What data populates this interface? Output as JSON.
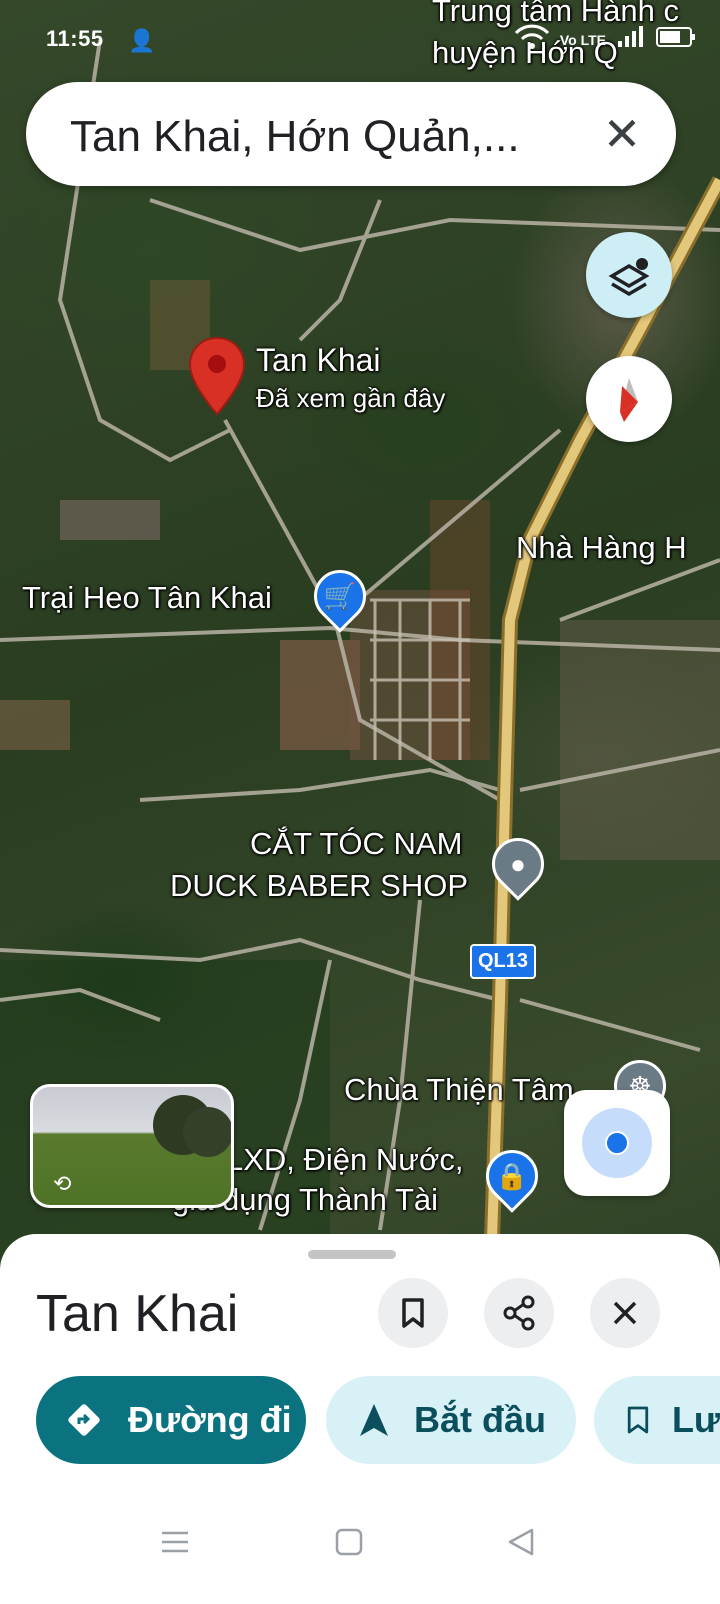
{
  "status_bar": {
    "time": "11:55",
    "network_label": "Vo LTE",
    "icons": [
      "person-add-icon",
      "wifi-icon",
      "signal-icon",
      "battery-icon"
    ]
  },
  "search": {
    "query": "Tan Khai, Hớn Quản,...",
    "clear_icon": "close-icon"
  },
  "map": {
    "top_label": "Trung tâm Hành c\nhuyện Hớn Q",
    "selected_place": {
      "name": "Tan Khai",
      "subtitle": "Đã xem gần đây"
    },
    "labels": {
      "restaurant": "Nhà Hàng H",
      "pig_farm": "Trại Heo Tân Khai",
      "barber_line1": "CẮT TÓC NAM",
      "barber_line2": "DUCK BABER SHOP",
      "road_badge": "QL13",
      "temple": "Chùa Thiện Tâm",
      "store_line1": "LXD, Điện Nước,",
      "store_line2": "gia dụng Thành Tài"
    },
    "colors": {
      "pin_red": "#d93025",
      "poi_blue": "#1a73e8",
      "highway": "#d4b56a",
      "location_blue": "#1a73e8"
    }
  },
  "sheet": {
    "title": "Tan Khai",
    "buttons": {
      "save_icon": "bookmark-icon",
      "share_icon": "share-icon",
      "close_icon": "close-icon"
    },
    "chips": {
      "directions": "Đường đi",
      "start": "Bắt đầu",
      "save": "Lư"
    },
    "colors": {
      "primary": "#0b7380",
      "chip_bg": "#d7f1f7"
    }
  },
  "nav_bar": {
    "icons": [
      "menu-icon",
      "home-icon",
      "back-icon"
    ]
  }
}
